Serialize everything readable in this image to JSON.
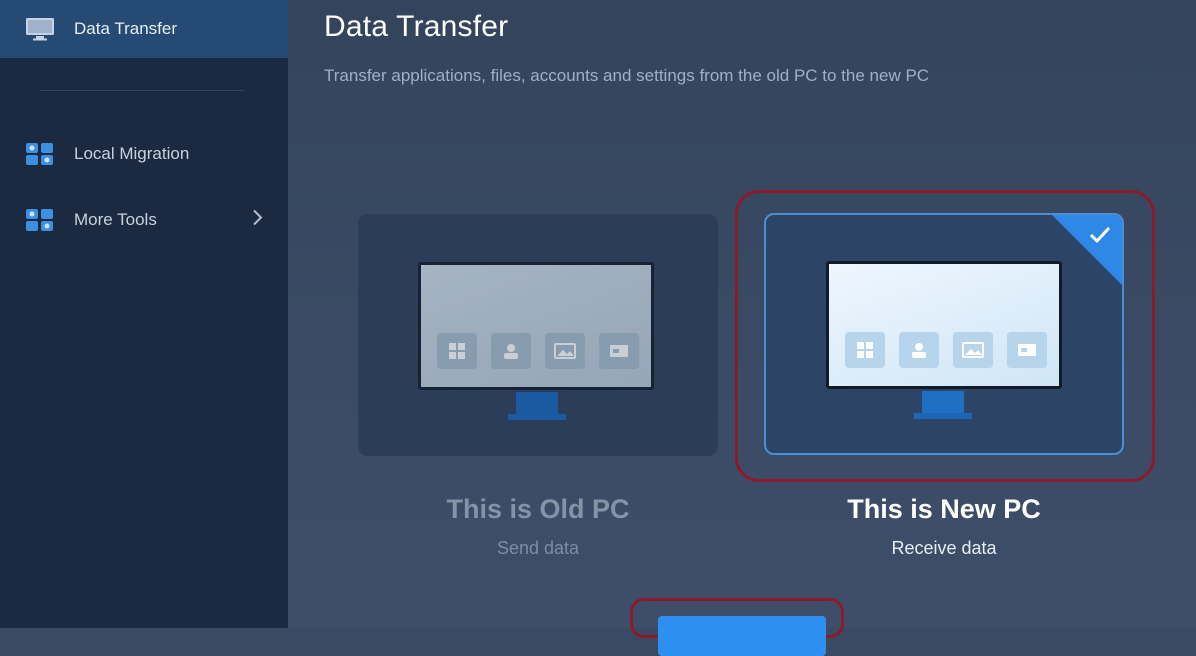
{
  "sidebar": {
    "items": [
      {
        "label": "Data Transfer",
        "icon": "monitor-icon",
        "active": true
      },
      {
        "label": "Local Migration",
        "icon": "migration-icon"
      },
      {
        "label": "More Tools",
        "icon": "tools-icon"
      }
    ]
  },
  "main": {
    "title": "Data Transfer",
    "subtitle": "Transfer applications, files, accounts and settings from the old PC to the new PC",
    "options": [
      {
        "label": "This is Old PC",
        "sublabel": "Send data",
        "selected": false
      },
      {
        "label": "This is New PC",
        "sublabel": "Receive data",
        "selected": true
      }
    ],
    "next_button_label": ""
  },
  "colors": {
    "sidebar_bg": "#1c2a41",
    "active_item": "#254a73",
    "accent": "#2d8ff0",
    "annotation_red": "#8b1a2a"
  }
}
